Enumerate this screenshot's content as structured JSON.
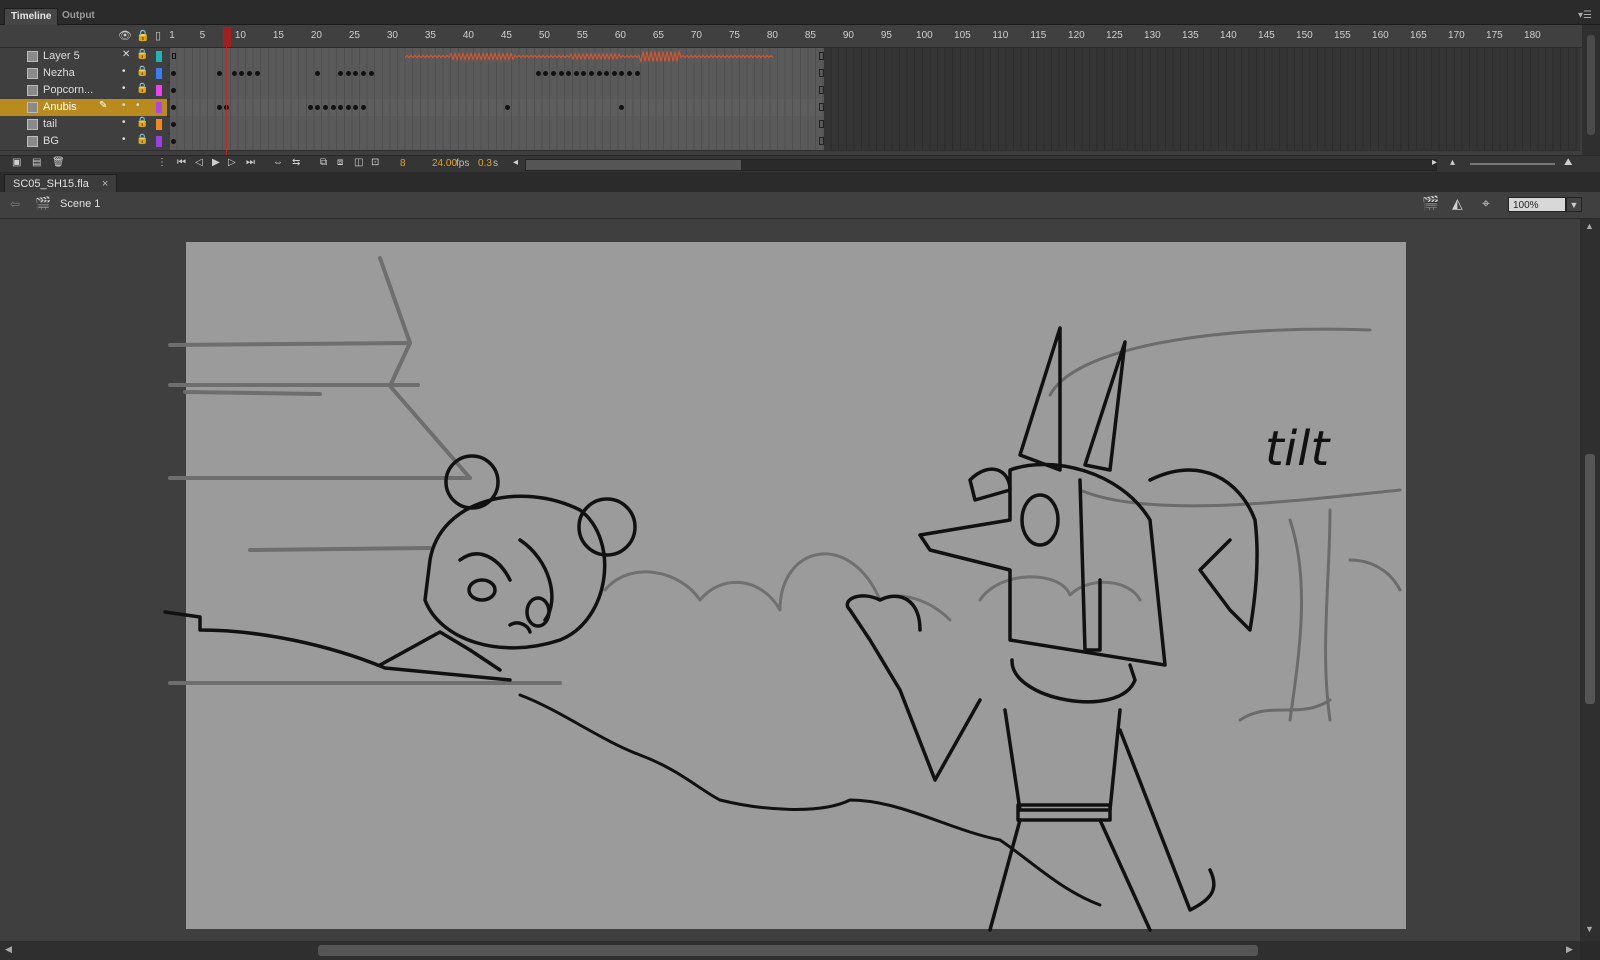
{
  "panel_tabs": [
    "Timeline",
    "Output"
  ],
  "layers": [
    {
      "name": "Layer 5",
      "color": "#1fb5b5",
      "selected": false
    },
    {
      "name": "Nezha",
      "color": "#3a7ef0",
      "selected": false
    },
    {
      "name": "Popcorn...",
      "color": "#ef3fef",
      "selected": false
    },
    {
      "name": "Anubis",
      "color": "#b046e0",
      "selected": true
    },
    {
      "name": "tail",
      "color": "#f08a1a",
      "selected": false
    },
    {
      "name": "BG",
      "color": "#9a3fe0",
      "selected": false
    }
  ],
  "ruler_marks": [
    "1",
    "5",
    "10",
    "15",
    "20",
    "25",
    "30",
    "35",
    "40",
    "45",
    "50",
    "55",
    "60",
    "65",
    "70",
    "75",
    "80",
    "85",
    "90",
    "95",
    "100",
    "105",
    "110",
    "115",
    "120",
    "125",
    "130",
    "135",
    "140",
    "145",
    "150",
    "155",
    "160",
    "165",
    "170",
    "175",
    "180"
  ],
  "footer": {
    "current_frame": "8",
    "fps": "24.00",
    "fps_unit": "fps",
    "elapsed": "0.3",
    "elapsed_unit": "s"
  },
  "document": {
    "tab_title": "SC05_SH15.fla",
    "close": "×",
    "scene": "Scene 1",
    "zoom": "100%"
  },
  "annotation": "tilt",
  "icons": {
    "eye": "eye-icon",
    "lock": "lock-icon",
    "outline": "outline-icon",
    "new_layer": "new-layer-icon",
    "folder": "new-folder-icon",
    "trash": "delete-icon",
    "first": "first-frame-icon",
    "prev": "step-back-icon",
    "play": "play-icon",
    "next": "step-forward-icon",
    "last": "last-frame-icon",
    "loop": "loop-icon",
    "center": "center-frame-icon",
    "onion": "onion-skin-icon",
    "scene": "scene-icon",
    "symbol": "symbol-icon",
    "snap": "snap-icon"
  }
}
